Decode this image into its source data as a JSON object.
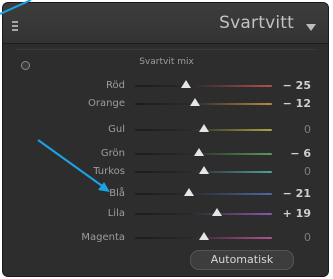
{
  "panel": {
    "title": "Svartvitt",
    "section_title": "Svartvit mix",
    "auto_button": "Automatisk",
    "sliders": [
      {
        "label": "Röd",
        "value": "− 25",
        "level": -25,
        "color": "#b64d4d"
      },
      {
        "label": "Orange",
        "value": "− 12",
        "level": -12,
        "color": "#b98a40"
      },
      {
        "label": "Gul",
        "value": "0",
        "level": 0,
        "color": "#a9a542"
      },
      {
        "label": "Grön",
        "value": "− 6",
        "level": -6,
        "color": "#5a9a55"
      },
      {
        "label": "Turkos",
        "value": "0",
        "level": 0,
        "color": "#4f9fa0"
      },
      {
        "label": "Blå",
        "value": "− 21",
        "level": -21,
        "color": "#4b6aa8"
      },
      {
        "label": "Lila",
        "value": "+ 19",
        "level": 19,
        "color": "#8b55b4"
      },
      {
        "label": "Magenta",
        "value": "0",
        "level": 0,
        "color": "#b44f8f"
      }
    ]
  },
  "annotation": {
    "arrow_color": "#1aa3e6"
  }
}
